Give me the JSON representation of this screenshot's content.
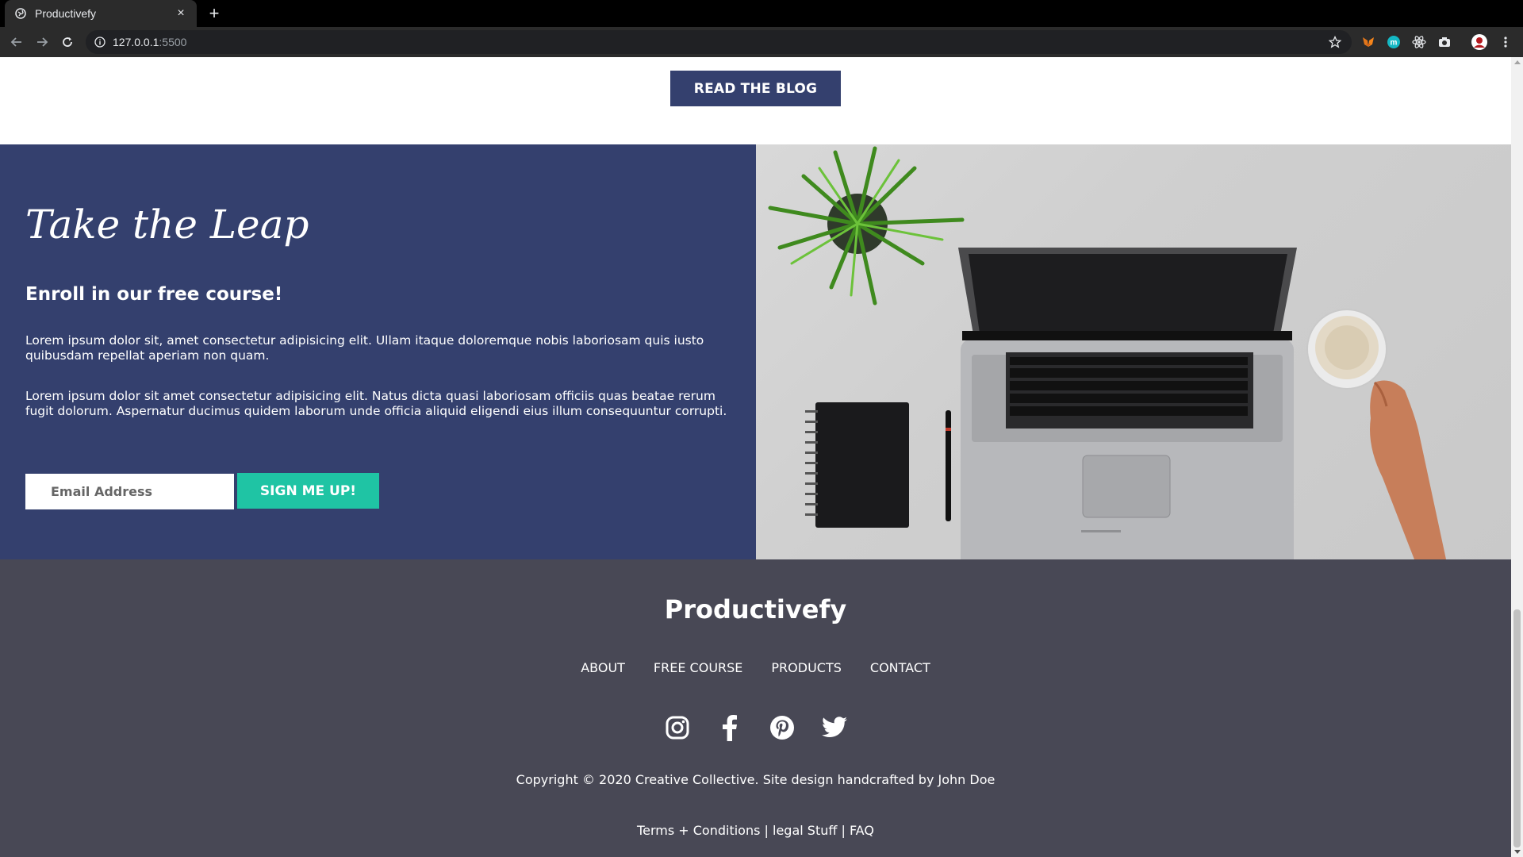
{
  "browser": {
    "tab_title": "Productivefy",
    "tab_close": "×",
    "new_tab": "+",
    "url_host": "127.0.0.1",
    "url_port": ":5500"
  },
  "blog": {
    "button_label": "READ THE BLOG"
  },
  "leap": {
    "title": "Take the Leap",
    "subtitle": "Enroll in our free course!",
    "paragraph1": "Lorem ipsum dolor sit, amet consectetur adipisicing elit. Ullam itaque doloremque nobis laboriosam quis iusto quibusdam repellat aperiam non quam.",
    "paragraph2": "Lorem ipsum dolor sit amet consectetur adipisicing elit. Natus dicta quasi laboriosam officiis quas beatae rerum fugit dolorum. Aspernatur ducimus quidem laborum unde officia aliquid eligendi eius illum consequuntur corrupti.",
    "email_placeholder": "Email Address",
    "signup_label": "SIGN ME UP!"
  },
  "footer": {
    "brand": "Productivefy",
    "nav": [
      "ABOUT",
      "FREE COURSE",
      "PRODUCTS",
      "CONTACT"
    ],
    "socials": [
      "instagram-icon",
      "facebook-icon",
      "pinterest-icon",
      "twitter-icon"
    ],
    "copyright": "Copyright © 2020 Creative Collective. Site design handcrafted by John Doe",
    "legal": {
      "terms": "Terms + Conditions",
      "sep1": " | ",
      "legal_stuff": "legal Stuff",
      "sep2": " | ",
      "faq": "FAQ"
    }
  },
  "colors": {
    "navy": "#34406e",
    "teal": "#1fc4a4",
    "footer": "#484855"
  }
}
